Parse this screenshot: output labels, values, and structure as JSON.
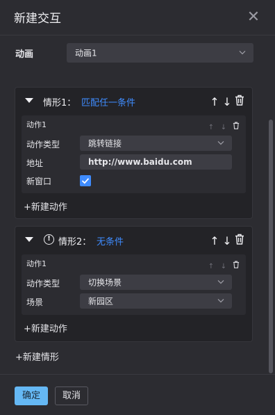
{
  "dialog": {
    "title": "新建交互",
    "close_icon": "close-icon"
  },
  "animation": {
    "label": "动画",
    "selected": "动画1"
  },
  "cases": [
    {
      "title": "情形1：",
      "condition": "匹配任一条件",
      "has_warning": false,
      "actions": [
        {
          "name": "动作1",
          "fields": {
            "type_label": "动作类型",
            "type_value": "跳转链接",
            "url_label": "地址",
            "url_value": "http://www.baidu.com",
            "new_window_label": "新窗口",
            "new_window_checked": true
          }
        }
      ],
      "add_action_label": "+新建动作"
    },
    {
      "title": "情形2：",
      "condition": "无条件",
      "has_warning": true,
      "actions": [
        {
          "name": "动作1",
          "fields": {
            "type_label": "动作类型",
            "type_value": "切换场景",
            "scene_label": "场景",
            "scene_value": "新园区"
          }
        }
      ],
      "add_action_label": "+新建动作"
    }
  ],
  "add_case_label": "+新建情形",
  "footer": {
    "ok_label": "确定",
    "cancel_label": "取消"
  },
  "colors": {
    "accent": "#3f8cff",
    "ok_button": "#65b8f4",
    "background": "#2c2c31"
  }
}
